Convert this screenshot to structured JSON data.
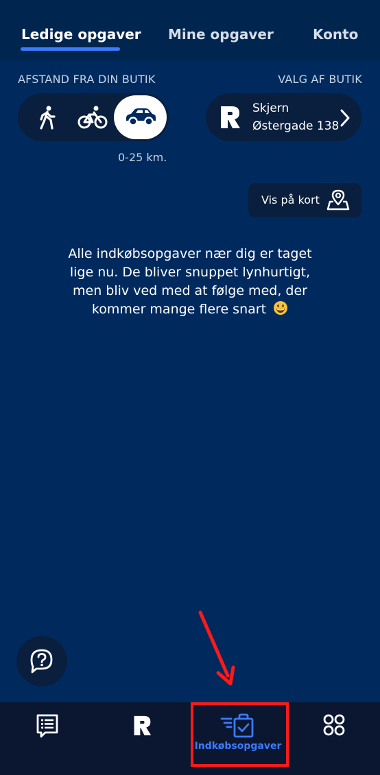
{
  "tabs": {
    "ledige": "Ledige opgaver",
    "mine": "Mine opgaver",
    "konto": "Konto",
    "active": "ledige"
  },
  "filters": {
    "distance_label": "AFSTAND FRA DIN BUTIK",
    "store_label": "VALG AF BUTIK",
    "modes": [
      "walk-icon",
      "bike-icon",
      "car-icon"
    ],
    "selected_mode": "car",
    "distance_range": "0-25 km."
  },
  "store": {
    "logo": "R",
    "city": "Skjern",
    "street": "Østergade 138"
  },
  "map_button": {
    "label": "Vis på kort",
    "icon": "map-pin-icon"
  },
  "empty_state": {
    "message": "Alle indkøbsopgaver nær dig er taget lige nu. De bliver snuppet lynhurtigt, men bliv ved med at følge med, der kommer mange flere snart",
    "emoji": "grinning-face-icon"
  },
  "help": {
    "icon": "question-icon"
  },
  "bottom_nav": {
    "items": [
      {
        "icon": "messages-icon",
        "label": ""
      },
      {
        "icon": "rema-logo-icon",
        "label": ""
      },
      {
        "icon": "shopping-tasks-icon",
        "label": "Indkøbsopgaver"
      },
      {
        "icon": "more-apps-icon",
        "label": ""
      }
    ],
    "active_index": 2
  },
  "colors": {
    "background": "#002a5e",
    "pill": "#0a1f3d",
    "accent": "#3b7bff",
    "annotation": "#ff1a1a"
  }
}
